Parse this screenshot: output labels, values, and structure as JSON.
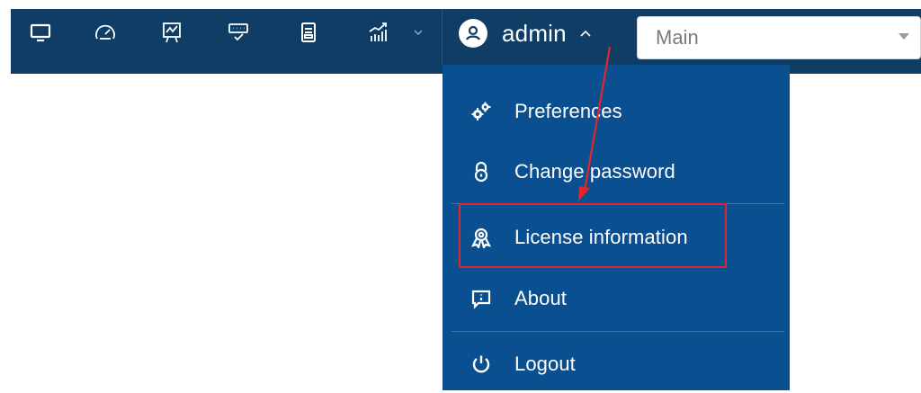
{
  "topbar": {
    "icons": [
      {
        "name": "monitor-icon"
      },
      {
        "name": "speedometer-icon"
      },
      {
        "name": "presentation-chart-icon"
      },
      {
        "name": "keyboard-check-icon"
      },
      {
        "name": "document-icon"
      },
      {
        "name": "statistics-icon"
      }
    ],
    "user": {
      "name": "admin",
      "avatar_icon": "user-avatar-icon",
      "expanded": true
    },
    "select": {
      "value": "Main"
    }
  },
  "user_dropdown": {
    "items": [
      {
        "label": "Preferences",
        "icon": "gears-icon"
      },
      {
        "label": "Change password",
        "icon": "lock-icon"
      },
      {
        "label": "License information",
        "icon": "award-ribbon-icon",
        "highlighted": true
      },
      {
        "label": "About",
        "icon": "info-box-icon"
      },
      {
        "label": "Logout",
        "icon": "power-icon"
      }
    ]
  },
  "colors": {
    "bar_bg": "#0f3d66",
    "dropdown_bg": "#0a4f8f",
    "highlight": "#e3262d",
    "text": "#ffffff"
  }
}
